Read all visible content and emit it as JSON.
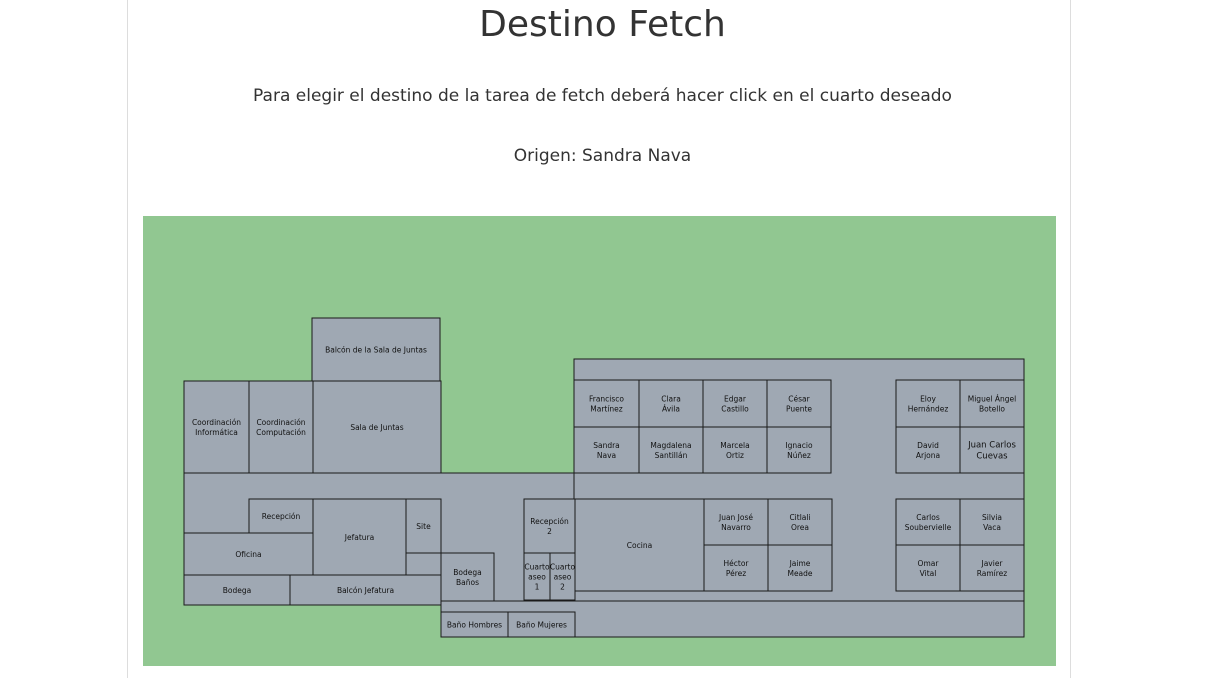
{
  "page": {
    "title": "Destino Fetch",
    "instruction": "Para elegir el destino de la tarea de fetch deberá hacer click en el cuarto deseado",
    "origin": "Origen: Sandra Nava"
  },
  "colors": {
    "map_background": "#91c791",
    "room_fill": "#9fa8b3",
    "wall": "#1a1a1a"
  },
  "rooms": {
    "balcon_sala_juntas": "Balcón de la Sala de Juntas",
    "coord_informatica": [
      "Coordinación",
      "Informática"
    ],
    "coord_computacion": [
      "Coordinación",
      "Computación"
    ],
    "sala_juntas": "Sala de Juntas",
    "francisco": [
      "Francisco",
      "Martínez"
    ],
    "clara": [
      "Clara",
      "Ávila"
    ],
    "edgar": [
      "Edgar",
      "Castillo"
    ],
    "cesar": [
      "César",
      "Puente"
    ],
    "sandra": [
      "Sandra",
      "Nava"
    ],
    "magdalena": [
      "Magdalena",
      "Santillán"
    ],
    "marcela": [
      "Marcela",
      "Ortiz"
    ],
    "ignacio": [
      "Ignacio",
      "Núñez"
    ],
    "eloy": [
      "Eloy",
      "Hernández"
    ],
    "miguel": [
      "Miguel Ángel",
      "Botello"
    ],
    "david": [
      "David",
      "Arjona"
    ],
    "juan_carlos": [
      "Juan Carlos",
      "Cuevas"
    ],
    "recepcion": "Recepción",
    "jefatura": "Jefatura",
    "site": "Site",
    "oficina": "Oficina",
    "bodega": "Bodega",
    "balcon_jefatura": "Balcón Jefatura",
    "bodega_banos": [
      "Bodega",
      "Baños"
    ],
    "recepcion2": [
      "Recepción",
      "2"
    ],
    "cuarto_aseo1": [
      "Cuarto",
      "aseo",
      "1"
    ],
    "cuarto_aseo2": [
      "Cuarto",
      "aseo",
      "2"
    ],
    "cocina": "Cocina",
    "juan_jose": [
      "Juan José",
      "Navarro"
    ],
    "citlali": [
      "Citlali",
      "Orea"
    ],
    "hector": [
      "Héctor",
      "Pérez"
    ],
    "jaime": [
      "Jaime",
      "Meade"
    ],
    "carlos": [
      "Carlos",
      "Soubervielle"
    ],
    "silvia": [
      "Silvia",
      "Vaca"
    ],
    "omar": [
      "Omar",
      "Vital"
    ],
    "javier": [
      "Javier",
      "Ramírez"
    ],
    "bano_hombres": "Baño Hombres",
    "bano_mujeres": "Baño Mujeres"
  }
}
